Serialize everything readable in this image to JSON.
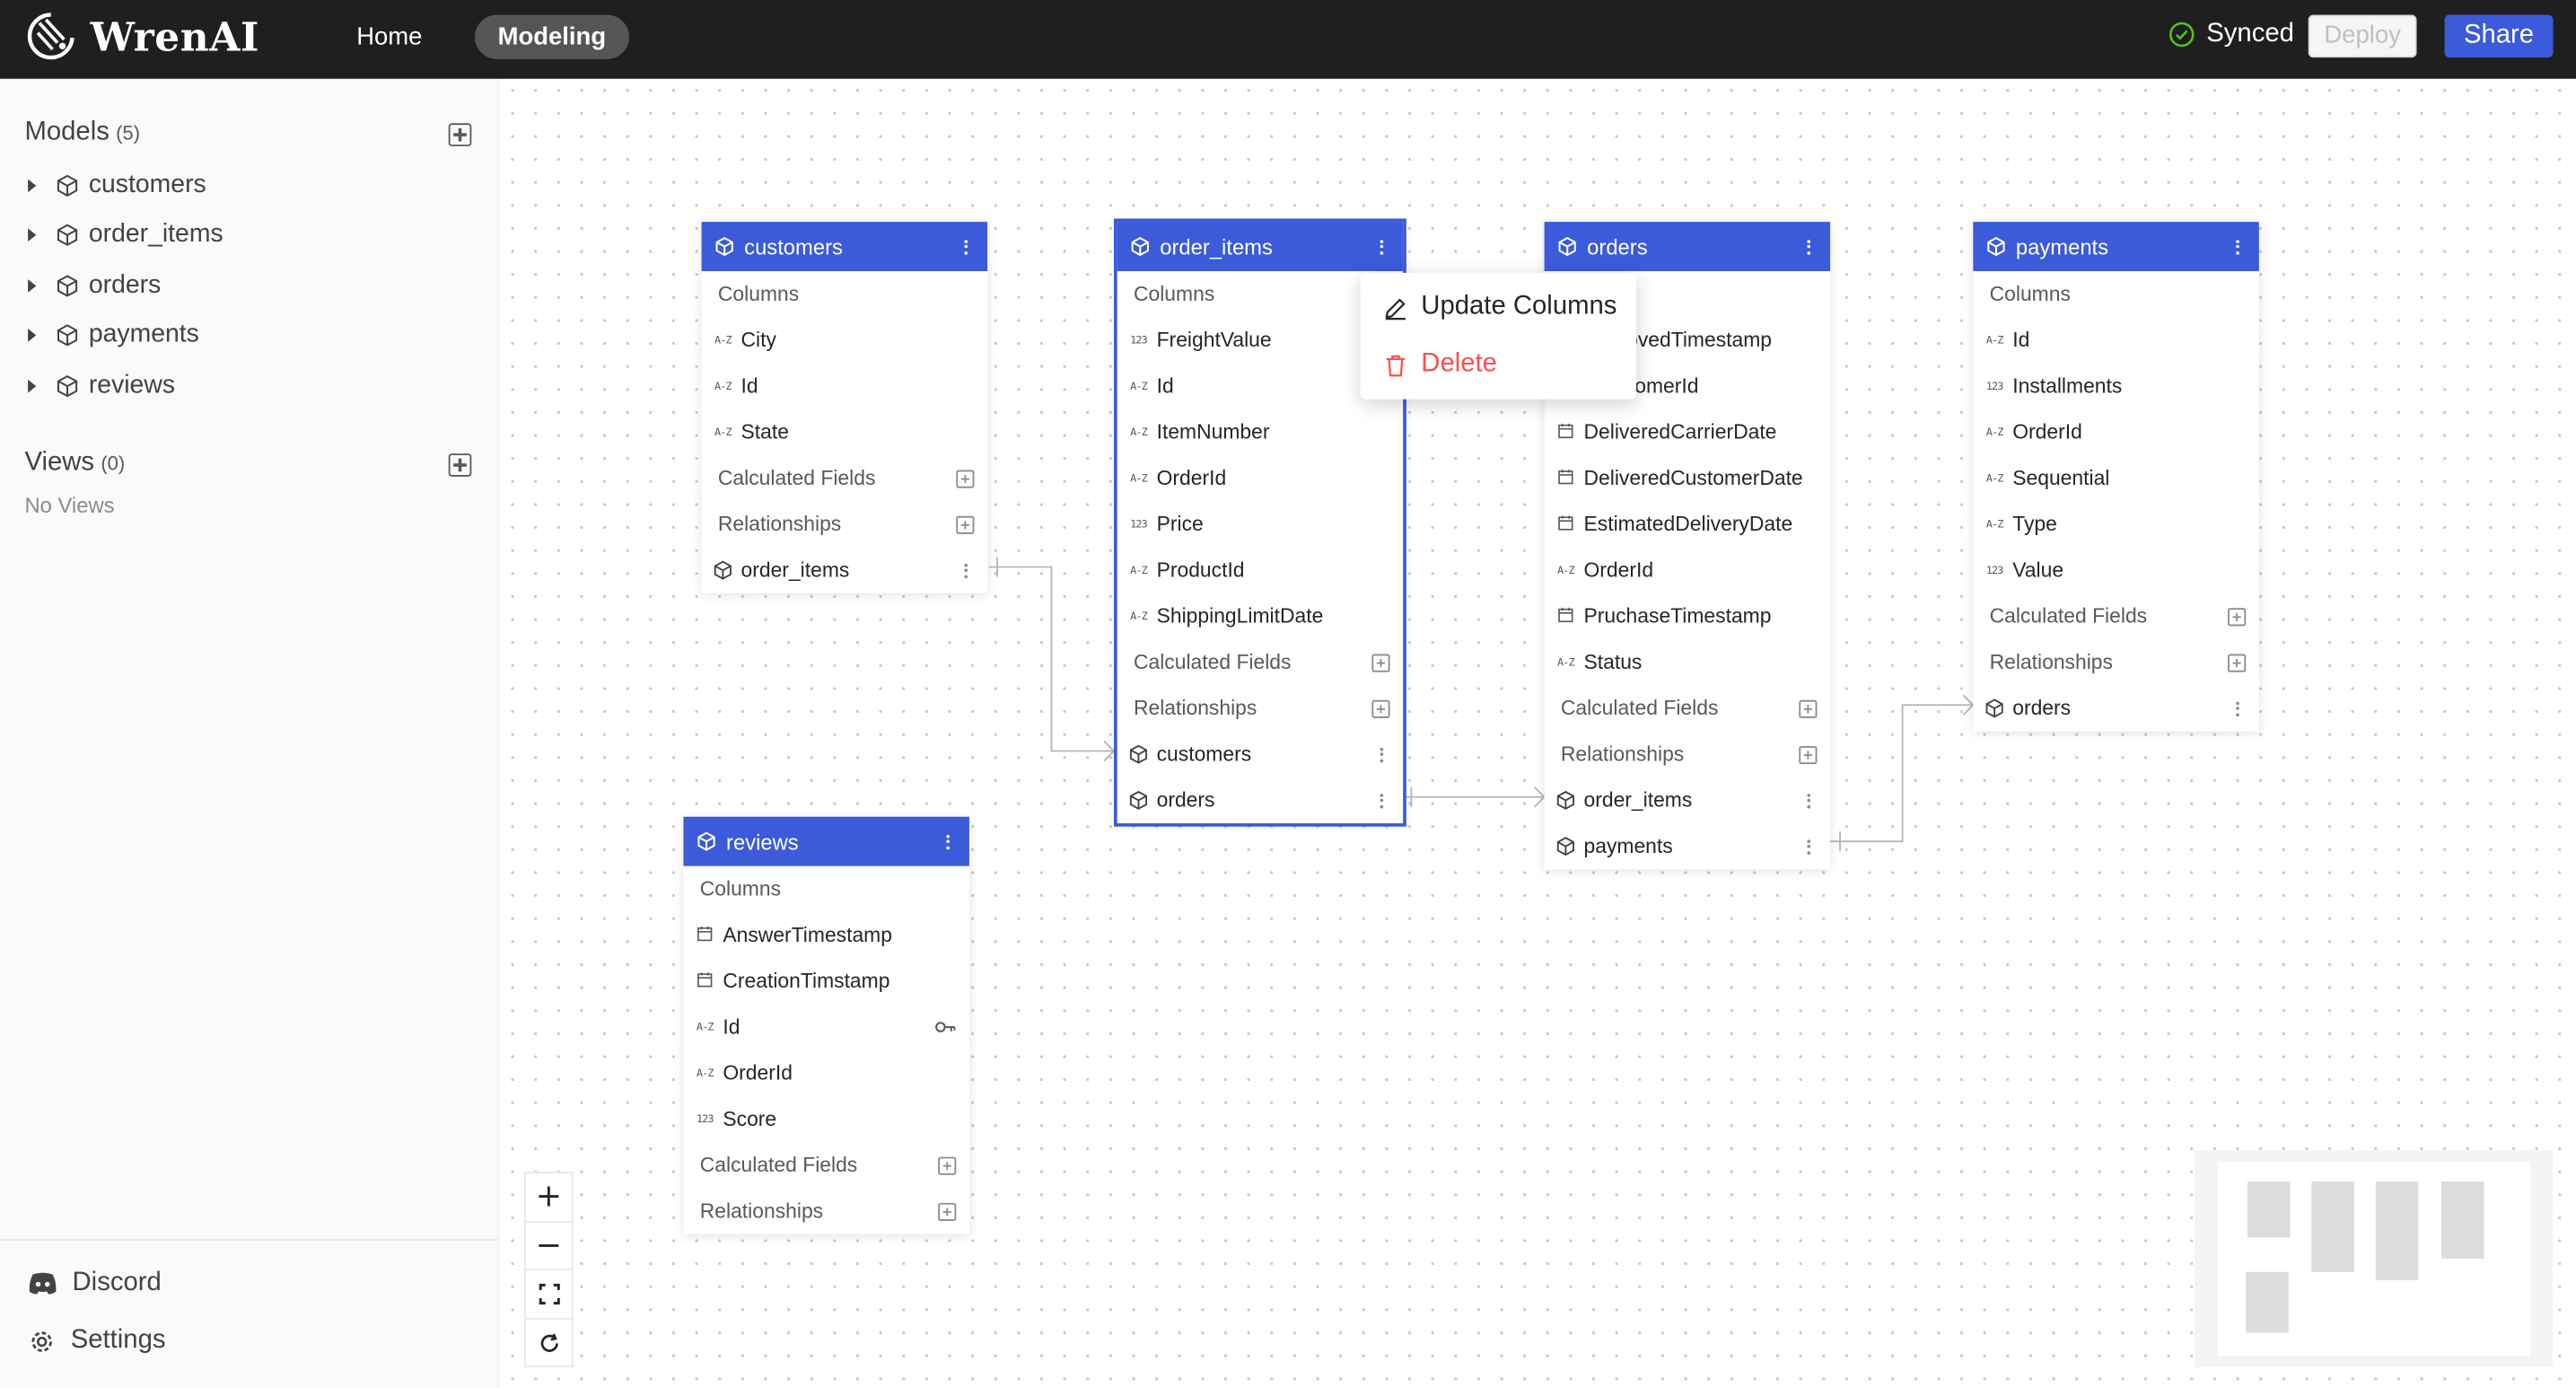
{
  "app": {
    "name": "WrenAI",
    "nav": {
      "home": "Home",
      "modeling": "Modeling"
    },
    "status": "Synced",
    "deploy_label": "Deploy",
    "share_label": "Share"
  },
  "sidebar": {
    "models_title": "Models",
    "models_count": "(5)",
    "models": [
      "customers",
      "order_items",
      "orders",
      "payments",
      "reviews"
    ],
    "views_title": "Views",
    "views_count": "(0)",
    "no_views": "No Views",
    "footer": {
      "discord": "Discord",
      "settings": "Settings"
    }
  },
  "canvas": {
    "section_labels": {
      "columns": "Columns",
      "calculated_fields": "Calculated Fields",
      "relationships": "Relationships"
    },
    "models": {
      "customers": {
        "title": "customers",
        "columns": [
          {
            "type": "A-Z",
            "name": "City"
          },
          {
            "type": "A-Z",
            "name": "Id"
          },
          {
            "type": "A-Z",
            "name": "State"
          }
        ],
        "relationships": [
          "order_items"
        ]
      },
      "order_items": {
        "title": "order_items",
        "columns": [
          {
            "type": "123",
            "name": "FreightValue"
          },
          {
            "type": "A-Z",
            "name": "Id"
          },
          {
            "type": "A-Z",
            "name": "ItemNumber"
          },
          {
            "type": "A-Z",
            "name": "OrderId"
          },
          {
            "type": "123",
            "name": "Price"
          },
          {
            "type": "A-Z",
            "name": "ProductId"
          },
          {
            "type": "A-Z",
            "name": "ShippingLimitDate"
          }
        ],
        "relationships": [
          "customers",
          "orders"
        ]
      },
      "orders": {
        "title": "orders",
        "columns_partial": "s",
        "columns": [
          {
            "type": "A-Z",
            "name": "ovedTimestamp"
          },
          {
            "type": "A-Z",
            "name": "omerId"
          },
          {
            "type": "date",
            "name": "DeliveredCarrierDate"
          },
          {
            "type": "date",
            "name": "DeliveredCustomerDate"
          },
          {
            "type": "date",
            "name": "EstimatedDeliveryDate"
          },
          {
            "type": "A-Z",
            "name": "OrderId"
          },
          {
            "type": "date",
            "name": "PruchaseTimestamp"
          },
          {
            "type": "A-Z",
            "name": "Status"
          }
        ],
        "relationships": [
          "order_items",
          "payments"
        ]
      },
      "payments": {
        "title": "payments",
        "columns": [
          {
            "type": "A-Z",
            "name": "Id"
          },
          {
            "type": "123",
            "name": "Installments"
          },
          {
            "type": "A-Z",
            "name": "OrderId"
          },
          {
            "type": "A-Z",
            "name": "Sequential"
          },
          {
            "type": "A-Z",
            "name": "Type"
          },
          {
            "type": "123",
            "name": "Value"
          }
        ],
        "relationships": [
          "orders"
        ]
      },
      "reviews": {
        "title": "reviews",
        "columns": [
          {
            "type": "date",
            "name": "AnswerTimestamp"
          },
          {
            "type": "date",
            "name": "CreationTimstamp"
          },
          {
            "type": "A-Z",
            "name": "Id",
            "primary_key": true
          },
          {
            "type": "A-Z",
            "name": "OrderId"
          },
          {
            "type": "123",
            "name": "Score"
          }
        ],
        "relationships": []
      }
    },
    "context_menu": {
      "update": "Update Columns",
      "delete": "Delete"
    }
  },
  "colors": {
    "accent": "#3b5bdb",
    "header_bg": "#1f1f1f",
    "danger": "#ff4d4f",
    "success": "#52c41a"
  }
}
